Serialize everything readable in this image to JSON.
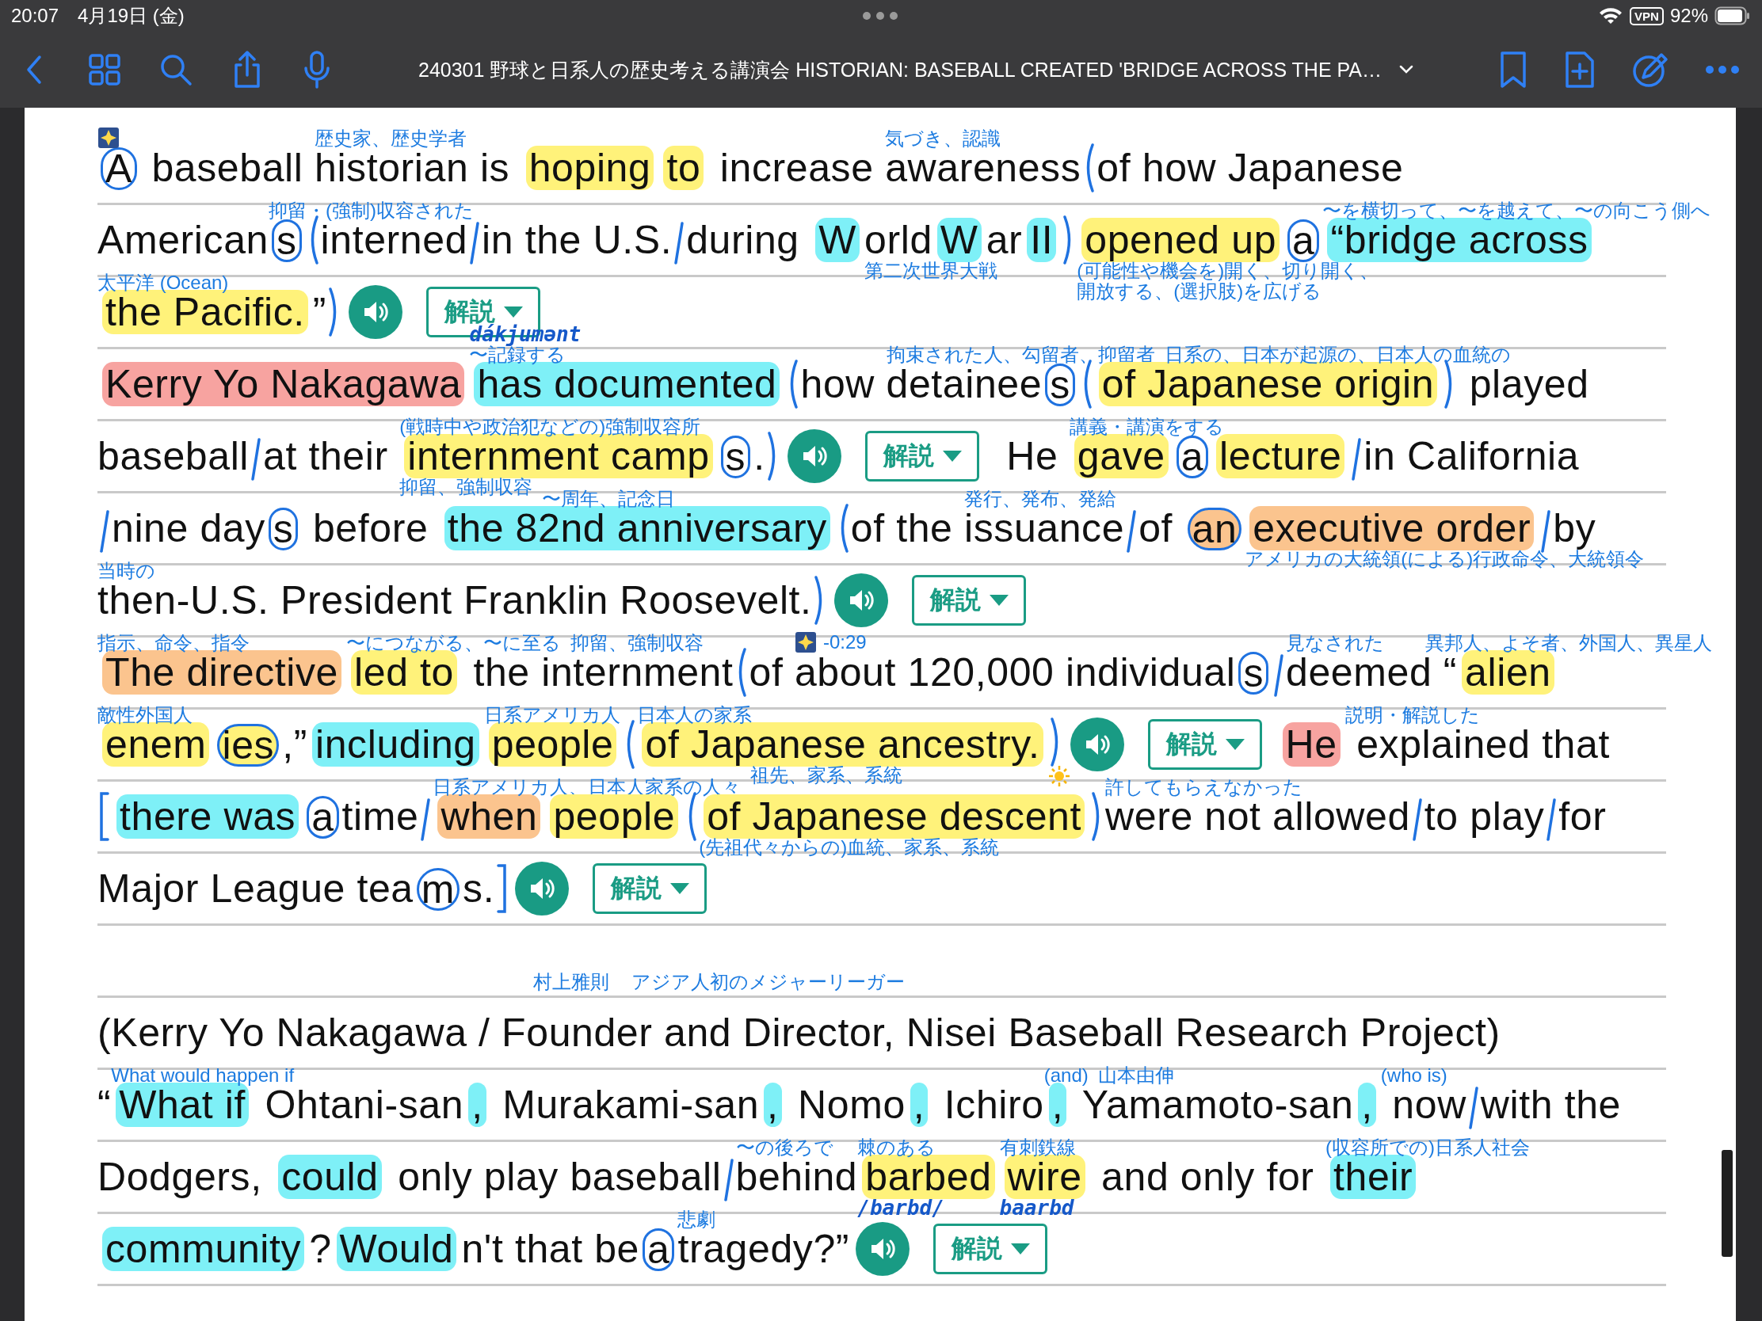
{
  "status_bar": {
    "time": "20:07",
    "date": "4月19日 (金)",
    "vpn": "VPN",
    "battery": "92%"
  },
  "toolbar": {
    "title": "240301 野球と日系人の歴史考える講演会 HISTORIAN: BASEBALL CREATED 'BRIDGE ACROSS THE PA…"
  },
  "rows": [
    {
      "segments": [
        {
          "kind": "circled",
          "text": "A",
          "icons_above": [
            {
              "kind": "sparkle"
            }
          ]
        },
        {
          "kind": "text",
          "text": " baseball "
        },
        {
          "kind": "text",
          "text": "historian",
          "notes_above": [
            {
              "text": "歴史家、歴史学者",
              "kind": "print"
            }
          ]
        },
        {
          "kind": "text",
          "text": " is "
        },
        {
          "kind": "text",
          "text": "hoping",
          "color": "#fff27a"
        },
        {
          "kind": "text",
          "text": "to",
          "color": "#fff27a"
        },
        {
          "kind": "text",
          "text": " increase "
        },
        {
          "kind": "text",
          "text": "awareness",
          "notes_above": [
            {
              "text": "気づき、認識",
              "kind": "print"
            }
          ]
        },
        {
          "kind": "open-paren"
        },
        {
          "kind": "text",
          "text": "of how Japanese"
        }
      ]
    },
    {
      "segments": [
        {
          "kind": "text",
          "text": "American"
        },
        {
          "kind": "circled",
          "text": "s",
          "notes_above": [
            {
              "text": "抑留・(強制)収容された",
              "kind": "print"
            }
          ]
        },
        {
          "kind": "open-paren"
        },
        {
          "kind": "text",
          "text": "interned"
        },
        {
          "kind": "slash"
        },
        {
          "kind": "text",
          "text": "in the U.S."
        },
        {
          "kind": "slash"
        },
        {
          "kind": "text",
          "text": "during "
        },
        {
          "kind": "text",
          "text": "W",
          "color": "#7ef0f7"
        },
        {
          "kind": "text",
          "text": "orld",
          "notes_below": [
            {
              "text": "第二次世界大戦",
              "kind": "print"
            }
          ]
        },
        {
          "kind": "text",
          "text": "W",
          "color": "#7ef0f7"
        },
        {
          "kind": "text",
          "text": "ar"
        },
        {
          "kind": "text",
          "text": "II",
          "color": "#7ef0f7"
        },
        {
          "kind": "close-paren"
        },
        {
          "kind": "text",
          "text": "opened up",
          "color": "#fff27a",
          "notes_below": [
            {
              "text": "(可能性や機会を)開く、切り開く、",
              "kind": "print"
            },
            {
              "text": "開放する、(選択肢)を広げる",
              "kind": "print"
            }
          ]
        },
        {
          "kind": "circled",
          "text": "a"
        },
        {
          "kind": "text",
          "text": "“bridge across",
          "color": "#7ef0f7",
          "notes_above": [
            {
              "text": "〜を横切って、〜を越えて、〜の向こう側へ",
              "kind": "print"
            }
          ]
        }
      ]
    },
    {
      "segments": [
        {
          "kind": "text",
          "text": "the Pacific.",
          "color": "#fff27a",
          "notes_above": [
            {
              "text": "太平洋 (Ocean)",
              "kind": "print"
            }
          ]
        },
        {
          "kind": "text",
          "text": "”"
        },
        {
          "kind": "close-paren"
        },
        {
          "kind": "speaker"
        },
        {
          "kind": "explain",
          "label": "解説"
        }
      ]
    },
    {
      "segments": [
        {
          "kind": "text",
          "text": "Kerry Yo Nakagawa",
          "color": "#f7a3a0"
        },
        {
          "kind": "text",
          "text": "has documented",
          "color": "#7ef0f7",
          "notes_above": [
            {
              "text": "dákjumənt",
              "kind": "hand"
            },
            {
              "text": "〜記録する",
              "kind": "print"
            }
          ]
        },
        {
          "kind": "open-paren"
        },
        {
          "kind": "text",
          "text": "how "
        },
        {
          "kind": "text",
          "text": "detainee",
          "notes_above": [
            {
              "text": "拘束された人、勾留者、抑留者",
              "kind": "print"
            }
          ]
        },
        {
          "kind": "circled",
          "text": "s"
        },
        {
          "kind": "open-paren"
        },
        {
          "kind": "text",
          "text": "of Japanese origin",
          "color": "#fff27a",
          "notes_above": [
            {
              "text": "日系の、日本が起源の、日本人の血統の",
              "kind": "print"
            }
          ]
        },
        {
          "kind": "close-paren"
        },
        {
          "kind": "text",
          "text": " played"
        }
      ]
    },
    {
      "segments": [
        {
          "kind": "text",
          "text": "baseball"
        },
        {
          "kind": "slash"
        },
        {
          "kind": "text",
          "text": "at their "
        },
        {
          "kind": "text",
          "text": "internment camp",
          "color": "#fff27a",
          "notes_above": [
            {
              "text": "(戦時中や政治犯などの)強制収容所",
              "kind": "print"
            }
          ],
          "notes_below": [
            {
              "text": "抑留、強制収容",
              "kind": "print"
            }
          ]
        },
        {
          "kind": "circled",
          "text": "s"
        },
        {
          "kind": "text",
          "text": "."
        },
        {
          "kind": "close-paren"
        },
        {
          "kind": "speaker"
        },
        {
          "kind": "explain",
          "label": "解説"
        },
        {
          "kind": "text",
          "text": " He "
        },
        {
          "kind": "text",
          "text": "gave",
          "color": "#fff27a",
          "notes_above": [
            {
              "text": "講義・講演をする",
              "kind": "print"
            }
          ]
        },
        {
          "kind": "circled",
          "text": "a"
        },
        {
          "kind": "text",
          "text": "lecture",
          "color": "#fff27a"
        },
        {
          "kind": "slash"
        },
        {
          "kind": "text",
          "text": "in California"
        }
      ]
    },
    {
      "segments": [
        {
          "kind": "slash"
        },
        {
          "kind": "text",
          "text": "nine day"
        },
        {
          "kind": "circled",
          "text": "s"
        },
        {
          "kind": "text",
          "text": " before "
        },
        {
          "kind": "text",
          "text": "the 82nd anniversary",
          "color": "#7ef0f7",
          "notes_above": [
            {
              "text": "〜周年、記念日",
              "kind": "print"
            }
          ]
        },
        {
          "kind": "open-paren"
        },
        {
          "kind": "text",
          "text": "of the "
        },
        {
          "kind": "text",
          "text": "issuance",
          "notes_above": [
            {
              "text": "発行、発布、発給",
              "kind": "print"
            }
          ]
        },
        {
          "kind": "slash"
        },
        {
          "kind": "text",
          "text": "of "
        },
        {
          "kind": "circled",
          "text": "an",
          "color": "#fbc48e"
        },
        {
          "kind": "text",
          "text": "executive order",
          "color": "#fbc48e",
          "notes_below": [
            {
              "text": "アメリカの大統領(による)行政命令、大統領令",
              "kind": "print"
            }
          ]
        },
        {
          "kind": "slash"
        },
        {
          "kind": "text",
          "text": "by"
        }
      ]
    },
    {
      "segments": [
        {
          "kind": "text",
          "text": "then-U.S.",
          "notes_above": [
            {
              "text": "当時の",
              "kind": "print"
            }
          ]
        },
        {
          "kind": "text",
          "text": " President Franklin Roosevelt."
        },
        {
          "kind": "close-paren"
        },
        {
          "kind": "speaker"
        },
        {
          "kind": "explain",
          "label": "解説"
        }
      ]
    },
    {
      "segments": [
        {
          "kind": "text",
          "text": "The directive",
          "color": "#fbc48e",
          "notes_above": [
            {
              "text": "指示、命令、指令",
              "kind": "print"
            }
          ]
        },
        {
          "kind": "text",
          "text": "led to",
          "color": "#fff27a",
          "notes_above": [
            {
              "text": "〜につながる、〜に至る",
              "kind": "print"
            }
          ]
        },
        {
          "kind": "text",
          "text": " the "
        },
        {
          "kind": "text",
          "text": "internment",
          "notes_above": [
            {
              "text": "抑留、強制収容",
              "kind": "print"
            }
          ]
        },
        {
          "kind": "open-paren"
        },
        {
          "kind": "text",
          "text": "of "
        },
        {
          "kind": "text",
          "text": "about 120,000",
          "icons_above": [
            {
              "kind": "sparkle"
            }
          ],
          "notes_above": [
            {
              "text": "-0:29",
              "kind": "print"
            }
          ]
        },
        {
          "kind": "text",
          "text": " individual"
        },
        {
          "kind": "circled",
          "text": "s"
        },
        {
          "kind": "slash"
        },
        {
          "kind": "text",
          "text": "deemed",
          "notes_above": [
            {
              "text": "見なされた",
              "kind": "print"
            }
          ]
        },
        {
          "kind": "text",
          "text": " “"
        },
        {
          "kind": "text",
          "text": "alien",
          "color": "#fff27a",
          "notes_above": [
            {
              "text": "異邦人、よそ者、外国人、異星人",
              "kind": "print"
            }
          ]
        }
      ]
    },
    {
      "segments": [
        {
          "kind": "text",
          "text": "enem",
          "color": "#fff27a",
          "notes_above": [
            {
              "text": "敵性外国人",
              "kind": "print"
            }
          ]
        },
        {
          "kind": "circled",
          "text": "ies",
          "color": "#fff27a"
        },
        {
          "kind": "text",
          "text": ",”"
        },
        {
          "kind": "text",
          "text": "including",
          "color": "#7ef0f7"
        },
        {
          "kind": "text",
          "text": "people",
          "color": "#fff27a",
          "notes_above": [
            {
              "text": "日系アメリカ人",
              "kind": "print"
            }
          ]
        },
        {
          "kind": "open-paren"
        },
        {
          "kind": "text",
          "text": "of Japanese ancestry.",
          "color": "#fff27a",
          "notes_above": [
            {
              "text": "日本人の家系",
              "kind": "print"
            }
          ],
          "notes_below": [
            {
              "text": "祖先、家系、系統",
              "kind": "print"
            }
          ]
        },
        {
          "kind": "close-paren",
          "icons_below": [
            {
              "kind": "sun"
            }
          ]
        },
        {
          "kind": "speaker"
        },
        {
          "kind": "explain",
          "label": "解説"
        },
        {
          "kind": "text",
          "text": "He",
          "color": "#f7a3a0"
        },
        {
          "kind": "text",
          "text": " explained",
          "notes_above": [
            {
              "text": "説明・解説した",
              "kind": "print"
            }
          ]
        },
        {
          "kind": "text",
          "text": " that"
        }
      ]
    },
    {
      "segments": [
        {
          "kind": "square-open"
        },
        {
          "kind": "text",
          "text": "there was",
          "color": "#7ef0f7"
        },
        {
          "kind": "circled",
          "text": "a"
        },
        {
          "kind": "text",
          "text": "time"
        },
        {
          "kind": "slash"
        },
        {
          "kind": "text",
          "text": "when",
          "color": "#fbc48e",
          "notes_above": [
            {
              "text": "日系アメリカ人、日本人家系の人々",
              "kind": "print"
            }
          ]
        },
        {
          "kind": "text",
          "text": "people",
          "color": "#fff27a"
        },
        {
          "kind": "open-paren"
        },
        {
          "kind": "text",
          "text": "of Japanese descent",
          "color": "#fff27a",
          "notes_below": [
            {
              "text": "(先祖代々からの)血統、家系、系統",
              "kind": "print"
            }
          ]
        },
        {
          "kind": "close-paren"
        },
        {
          "kind": "text",
          "text": "were not allowed",
          "notes_above": [
            {
              "text": "許してもらえなかった",
              "kind": "print"
            }
          ]
        },
        {
          "kind": "slash"
        },
        {
          "kind": "text",
          "text": "to play"
        },
        {
          "kind": "slash"
        },
        {
          "kind": "text",
          "text": "for"
        }
      ]
    },
    {
      "segments": [
        {
          "kind": "text",
          "text": "Major League tea"
        },
        {
          "kind": "circled",
          "text": "m"
        },
        {
          "kind": "text",
          "text": "s."
        },
        {
          "kind": "square-close"
        },
        {
          "kind": "speaker"
        },
        {
          "kind": "explain",
          "label": "解説"
        }
      ]
    },
    {
      "notes": [
        {
          "text": "村上雅則",
          "kind": "print"
        },
        {
          "text": "アジア人初のメジャーリーガー",
          "kind": "print"
        }
      ]
    },
    {
      "segments": [
        {
          "kind": "text",
          "text": "(Kerry Yo Nakagawa / Founder and Director, Nisei Baseball Research Project)"
        }
      ]
    },
    {
      "segments": [
        {
          "kind": "text",
          "text": "“"
        },
        {
          "kind": "text",
          "text": "What if",
          "color": "#7ef0f7",
          "notes_above": [
            {
              "text": "What would happen if",
              "kind": "print"
            }
          ]
        },
        {
          "kind": "text",
          "text": " Ohtani-san"
        },
        {
          "kind": "text",
          "text": ",",
          "color": "#7ef0f7"
        },
        {
          "kind": "text",
          "text": " Murakami-san"
        },
        {
          "kind": "text",
          "text": ",",
          "color": "#7ef0f7"
        },
        {
          "kind": "text",
          "text": " Nomo"
        },
        {
          "kind": "text",
          "text": ",",
          "color": "#7ef0f7"
        },
        {
          "kind": "text",
          "text": " Ichiro"
        },
        {
          "kind": "text",
          "text": ",",
          "color": "#7ef0f7",
          "notes_above": [
            {
              "text": "(and)",
              "kind": "print"
            }
          ]
        },
        {
          "kind": "text",
          "text": " Yamamoto-san",
          "notes_above": [
            {
              "text": "山本由伸",
              "kind": "print"
            }
          ]
        },
        {
          "kind": "text",
          "text": ",",
          "color": "#7ef0f7"
        },
        {
          "kind": "text",
          "text": " now",
          "notes_above": [
            {
              "text": "(who is)",
              "kind": "print"
            }
          ]
        },
        {
          "kind": "slash"
        },
        {
          "kind": "text",
          "text": "with the"
        }
      ]
    },
    {
      "segments": [
        {
          "kind": "text",
          "text": "Dodgers, "
        },
        {
          "kind": "text",
          "text": "could",
          "color": "#7ef0f7"
        },
        {
          "kind": "text",
          "text": " only play baseball"
        },
        {
          "kind": "slash"
        },
        {
          "kind": "text",
          "text": "behind",
          "notes_above": [
            {
              "text": "〜の後ろで",
              "kind": "print"
            }
          ]
        },
        {
          "kind": "text",
          "text": "barbed",
          "color": "#fff27a",
          "notes_above": [
            {
              "text": "棘のある",
              "kind": "print"
            }
          ],
          "notes_below": [
            {
              "text": "/barbd/",
              "kind": "hand"
            }
          ]
        },
        {
          "kind": "text",
          "text": "wire",
          "color": "#fff27a",
          "notes_above": [
            {
              "text": "有刺鉄線",
              "kind": "print"
            }
          ],
          "notes_below": [
            {
              "text": "baarbd",
              "kind": "hand"
            }
          ]
        },
        {
          "kind": "text",
          "text": " and only for "
        },
        {
          "kind": "text",
          "text": "their",
          "color": "#7ef0f7",
          "notes_above": [
            {
              "text": "(収容所での)日系人社会",
              "kind": "print"
            }
          ]
        }
      ]
    },
    {
      "segments": [
        {
          "kind": "text",
          "text": "community",
          "color": "#7ef0f7"
        },
        {
          "kind": "text",
          "text": "?"
        },
        {
          "kind": "text",
          "text": "Would",
          "color": "#7ef0f7"
        },
        {
          "kind": "text",
          "text": "n't that be"
        },
        {
          "kind": "circled",
          "text": "a"
        },
        {
          "kind": "text",
          "text": "tragedy?”",
          "notes_above": [
            {
              "text": "悲劇",
              "kind": "print"
            }
          ]
        },
        {
          "kind": "speaker"
        },
        {
          "kind": "explain",
          "label": "解説"
        }
      ]
    }
  ]
}
